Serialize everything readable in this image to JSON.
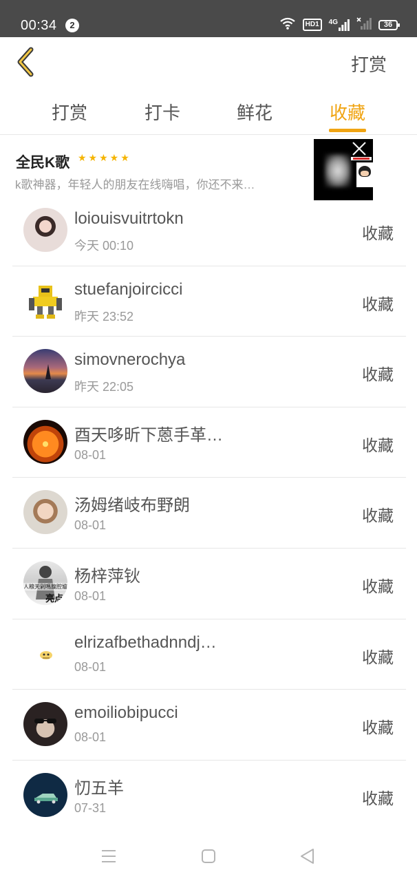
{
  "status_bar": {
    "time": "00:34",
    "notification_count": "2",
    "network_hd": "HD1",
    "network_type": "4G",
    "battery": "36"
  },
  "header": {
    "action_label": "打赏"
  },
  "tabs": [
    {
      "label": "打赏",
      "active": false
    },
    {
      "label": "打卡",
      "active": false
    },
    {
      "label": "鲜花",
      "active": false
    },
    {
      "label": "收藏",
      "active": true
    }
  ],
  "ad": {
    "title": "全民K歌",
    "stars": "★★★★★",
    "description": "k歌神器，年轻人的朋友在线嗨唱，你还不来…"
  },
  "list": [
    {
      "name": "loiouisvuitrtokn",
      "time": "今天 00:10",
      "action": "收藏"
    },
    {
      "name": "stuefanjoircicci",
      "time": "昨天 23:52",
      "action": "收藏"
    },
    {
      "name": "simovnerochya",
      "time": "昨天 22:05",
      "action": "收藏"
    },
    {
      "name": "酉天哆昕下蒽手革…",
      "time": "08-01",
      "action": "收藏"
    },
    {
      "name": "汤姆绪岐布野朗",
      "time": "08-01",
      "action": "收藏"
    },
    {
      "name": "杨梓萍钬",
      "time": "08-01",
      "action": "收藏"
    },
    {
      "name": "elrizafbethadnndj…",
      "time": "08-01",
      "action": "收藏"
    },
    {
      "name": "emoiliobipucci",
      "time": "08-01",
      "action": "收藏"
    },
    {
      "name": "忉五羊",
      "time": "07-31",
      "action": "收藏"
    }
  ],
  "avatar_texts": {
    "item6": "人粮天剁嗎腹腔尴",
    "item6_badge": "亮点"
  },
  "colors": {
    "accent": "#f0a412",
    "star": "#f5b400",
    "status_bar": "#4a4a4a",
    "text": "#555555",
    "subtext": "#999999"
  },
  "icons": {
    "back": "chevron-left-icon",
    "wifi": "wifi-icon",
    "signal": "signal-icon",
    "battery": "battery-icon",
    "close": "close-icon",
    "menu": "menu-icon",
    "home": "home-icon",
    "nav_back": "nav-back-icon"
  }
}
